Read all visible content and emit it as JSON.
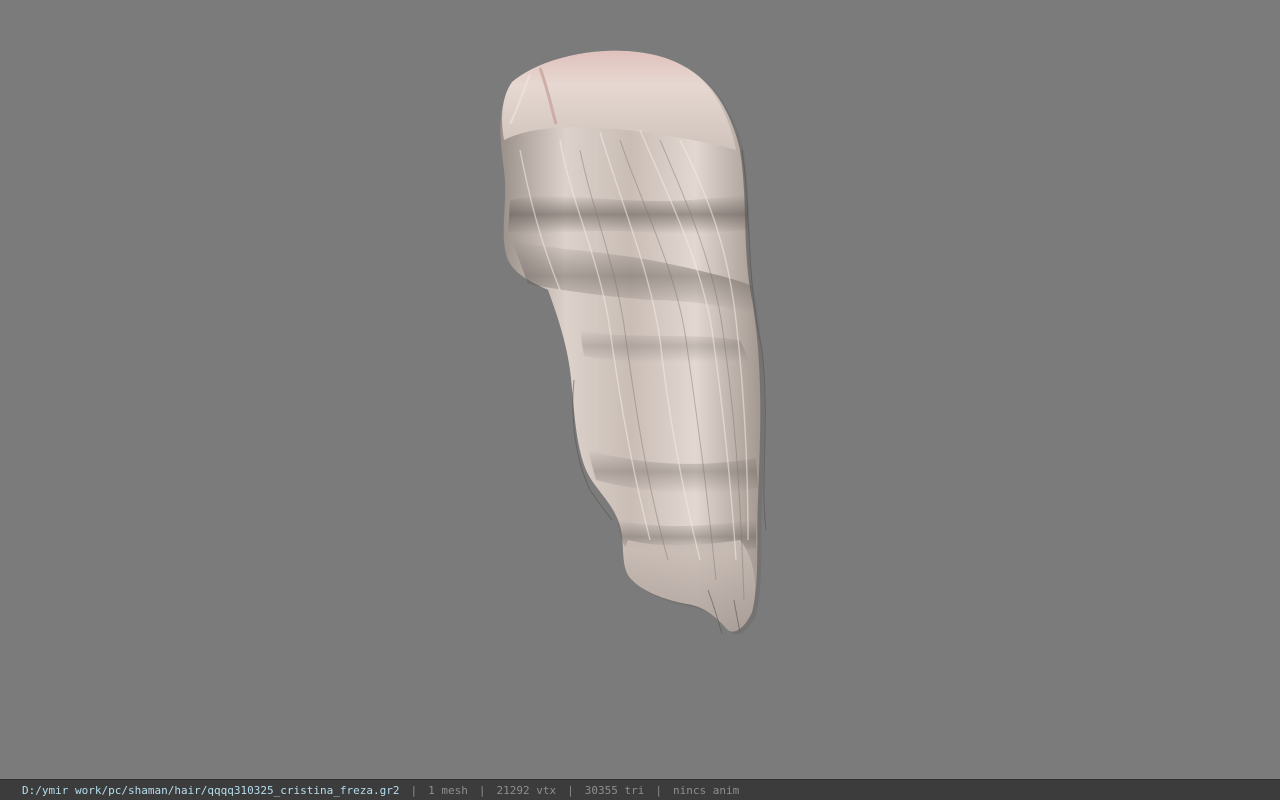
{
  "viewport": {
    "background": "#7b7b7b",
    "model_name": "hair-mesh"
  },
  "status": {
    "file_path": "D:/ymir work/pc/shaman/hair/qqqq310325_cristina_freza.gr2",
    "separator": "|",
    "mesh_count": "1 mesh",
    "vertex_count": "21292 vtx",
    "triangle_count": "30355 tri",
    "animation": "nincs anim"
  },
  "colors": {
    "status_bar_bg": "#3c3c3c",
    "path_text": "#b4ddee",
    "info_text": "#8e8e8e",
    "hair_light": "#e8dcd4",
    "hair_mid": "#c8bab2",
    "hair_dark": "#6a625e",
    "hair_root": "#d8b4ae"
  }
}
